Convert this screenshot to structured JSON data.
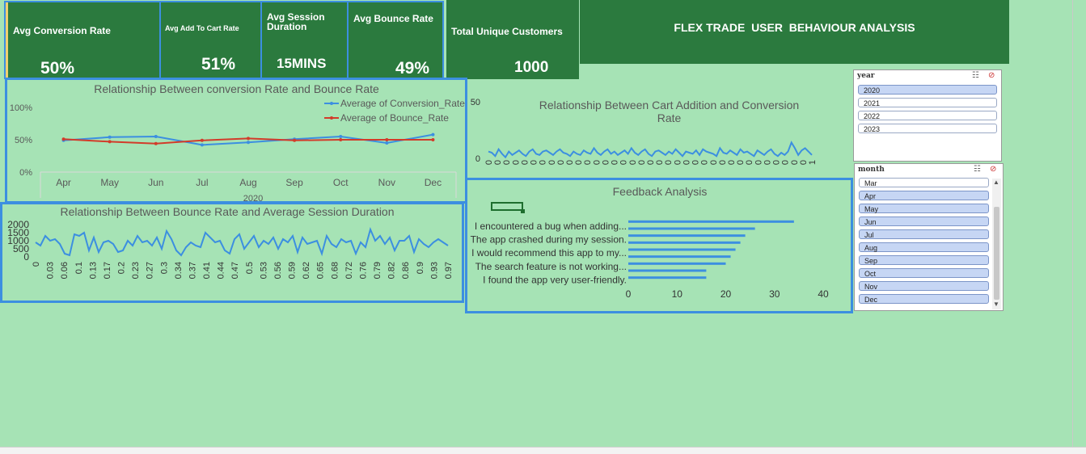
{
  "kpis": {
    "conversion": {
      "label": "Avg Conversion Rate",
      "value": "50%"
    },
    "cart": {
      "label": "Avg Add To Cart Rate",
      "value": "51%"
    },
    "session": {
      "label": "Avg Session Duration",
      "value": "15MINS"
    },
    "bounce": {
      "label": "Avg Bounce Rate",
      "value": "49%"
    },
    "customers": {
      "label": "Total Unique Customers",
      "value": "1000"
    }
  },
  "title": "FLEX TRADE  USER  BEHAVIOUR ANALYSIS",
  "slicers": {
    "year": {
      "header": "year",
      "items": [
        {
          "label": "2020",
          "selected": true
        },
        {
          "label": "2021",
          "selected": false
        },
        {
          "label": "2022",
          "selected": false
        },
        {
          "label": "2023",
          "selected": false
        }
      ]
    },
    "month": {
      "header": "month",
      "items": [
        {
          "label": "Mar",
          "selected": false
        },
        {
          "label": "Apr",
          "selected": true
        },
        {
          "label": "May",
          "selected": true
        },
        {
          "label": "Jun",
          "selected": true
        },
        {
          "label": "Jul",
          "selected": true
        },
        {
          "label": "Aug",
          "selected": true
        },
        {
          "label": "Sep",
          "selected": true
        },
        {
          "label": "Oct",
          "selected": true
        },
        {
          "label": "Nov",
          "selected": true
        },
        {
          "label": "Dec",
          "selected": true
        }
      ]
    }
  },
  "colors": {
    "kpi_bg": "#2b7a3e",
    "canvas": "#a6e3b5",
    "blue_series": "#3c8fe0",
    "red_series": "#d23b2a",
    "selection": "#3c8fe0"
  },
  "chart_data": [
    {
      "id": "conv_bounce",
      "type": "line",
      "title": "Relationship Between conversion Rate and Bounce Rate",
      "categories": [
        "Apr",
        "May",
        "Jun",
        "Jul",
        "Aug",
        "Sep",
        "Oct",
        "Nov",
        "Dec"
      ],
      "group_label": "2020",
      "y_ticks": [
        "0%",
        "50%",
        "100%"
      ],
      "ylim": [
        0,
        100
      ],
      "legend_position": "top-right",
      "series": [
        {
          "name": "Average of Conversion_Rate",
          "values": [
            49,
            54,
            55,
            42,
            46,
            51,
            55,
            45,
            58
          ]
        },
        {
          "name": "Average of Bounce_Rate",
          "values": [
            51,
            47,
            44,
            49,
            52,
            49,
            50,
            50,
            50
          ]
        }
      ]
    },
    {
      "id": "bounce_session",
      "type": "line",
      "title": "Relationship Between Bounce Rate and Average Session Duration",
      "y_ticks": [
        "0",
        "500",
        "1000",
        "1500",
        "2000"
      ],
      "ylim": [
        0,
        2000
      ],
      "x_tick_labels": [
        "0",
        "0.03",
        "0.06",
        "0.1",
        "0.13",
        "0.17",
        "0.2",
        "0.23",
        "0.27",
        "0.3",
        "0.34",
        "0.37",
        "0.41",
        "0.44",
        "0.47",
        "0.5",
        "0.53",
        "0.56",
        "0.59",
        "0.62",
        "0.65",
        "0.68",
        "0.72",
        "0.76",
        "0.79",
        "0.82",
        "0.86",
        "0.9",
        "0.93",
        "0.97"
      ],
      "values": [
        900,
        700,
        1300,
        1000,
        1100,
        800,
        200,
        100,
        1400,
        1300,
        1500,
        400,
        1200,
        300,
        900,
        1000,
        800,
        300,
        400,
        1000,
        700,
        1300,
        900,
        1000,
        700,
        1200,
        500,
        1600,
        1100,
        400,
        100,
        600,
        900,
        700,
        600,
        1500,
        1200,
        900,
        1000,
        400,
        200,
        1100,
        1400,
        500,
        900,
        1300,
        600,
        1000,
        800,
        1200,
        500,
        1100,
        900,
        1300,
        300,
        1200,
        800,
        900,
        1000,
        200,
        1300,
        800,
        600,
        1100,
        900,
        1000,
        200,
        900,
        600,
        1700,
        1000,
        1300,
        800,
        1200,
        400,
        1000,
        1000,
        1300,
        300,
        1100,
        800,
        600,
        900,
        1100,
        900,
        700
      ]
    },
    {
      "id": "cart_conversion",
      "type": "line",
      "title": "Relationship Between Cart Addition and Conversion Rate",
      "y_ticks": [
        "0",
        "50"
      ],
      "ylim": [
        0,
        50
      ],
      "x_tick_labels": [
        "0",
        "0",
        "0",
        "0",
        "0",
        "0",
        "0",
        "0",
        "0",
        "0",
        "0",
        "0",
        "0",
        "0",
        "0",
        "0",
        "0",
        "0",
        "0",
        "0",
        "0",
        "0",
        "0",
        "0",
        "0",
        "0",
        "0",
        "0",
        "0",
        "0",
        "0",
        "0",
        "0",
        "0",
        "0",
        "0",
        "1"
      ],
      "values": [
        6,
        5,
        2,
        8,
        4,
        1,
        6,
        3,
        5,
        7,
        4,
        2,
        6,
        8,
        4,
        3,
        6,
        7,
        5,
        3,
        6,
        8,
        5,
        4,
        2,
        6,
        4,
        3,
        7,
        5,
        4,
        9,
        5,
        3,
        6,
        8,
        4,
        6,
        3,
        5,
        7,
        4,
        9,
        5,
        3,
        6,
        8,
        4,
        2,
        6,
        7,
        5,
        3,
        6,
        4,
        8,
        5,
        2,
        6,
        5,
        4,
        7,
        3,
        8,
        6,
        5,
        4,
        2,
        9,
        5,
        4,
        7,
        5,
        3,
        8,
        5,
        6,
        4,
        2,
        7,
        5,
        3,
        6,
        8,
        4,
        2,
        5,
        3,
        6,
        14,
        9,
        3,
        7,
        9,
        6,
        3
      ],
      "values_note_hidden": ""
    },
    {
      "id": "feedback",
      "type": "bar",
      "title": "Feedback Analysis",
      "orientation": "horizontal",
      "categories": [
        "I encountered a bug when adding...",
        "The app crashed during my session.",
        "I would recommend this app to my...",
        "The search feature is not working...",
        "I found the app very user-friendly."
      ],
      "bar_values": [
        34,
        26,
        24,
        23,
        22,
        21,
        20,
        16,
        16
      ],
      "xlim": [
        0,
        40
      ],
      "x_ticks": [
        "0",
        "10",
        "20",
        "30",
        "40"
      ]
    }
  ]
}
